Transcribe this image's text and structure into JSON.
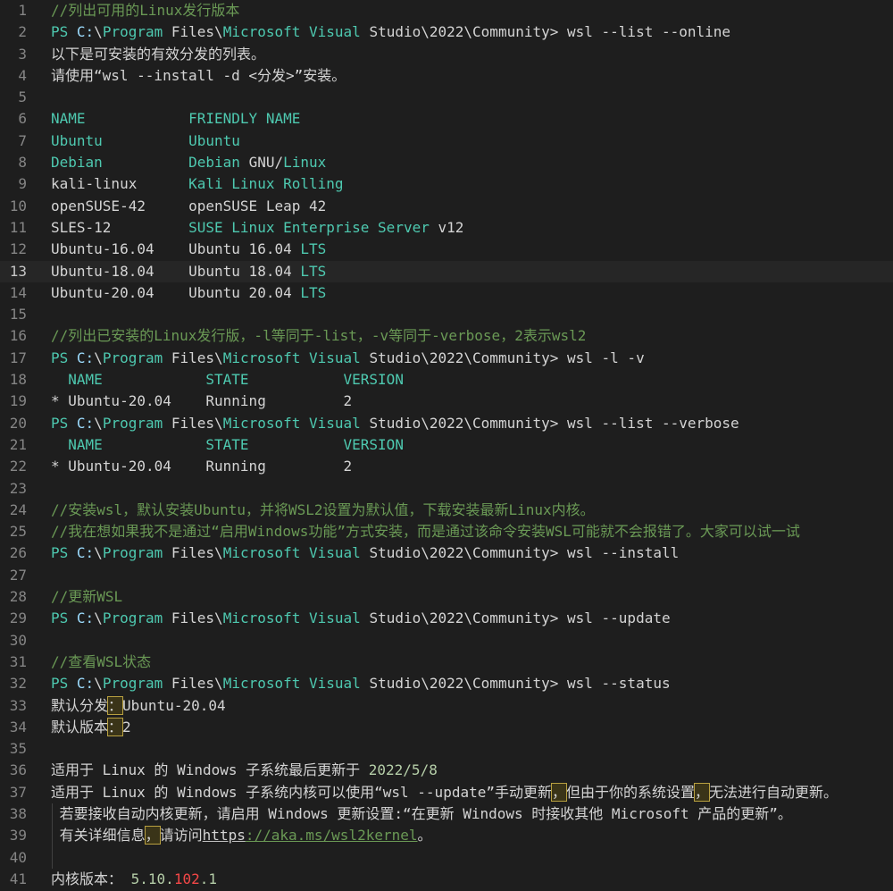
{
  "colors": {
    "background": "#1e1e1e",
    "comment": "#6a9955",
    "type": "#4ec9b0",
    "text": "#d4d4d4",
    "number": "#b5cea8",
    "error": "#f44747"
  },
  "current_line": 13,
  "lines": [
    [
      [
        "//列出可用的Linux发行版本",
        "c"
      ]
    ],
    [
      [
        "PS ",
        "t"
      ],
      [
        "C:",
        "b"
      ],
      [
        "\\",
        "w"
      ],
      [
        "Program",
        "t"
      ],
      [
        " Files\\",
        "w"
      ],
      [
        "Microsoft Visual",
        "t"
      ],
      [
        " Studio\\2022\\Community> wsl --list --online",
        "w"
      ]
    ],
    [
      [
        "以下是可安装的有效分发的列表。",
        "w"
      ]
    ],
    [
      [
        "请使用“wsl --install -d <分发>”安装。",
        "w"
      ]
    ],
    [],
    [
      [
        "NAME            FRIENDLY NAME",
        "t"
      ]
    ],
    [
      [
        "Ubuntu          Ubuntu",
        "t"
      ]
    ],
    [
      [
        "Debian          Debian ",
        "t"
      ],
      [
        "GNU/",
        "w"
      ],
      [
        "Linux",
        "t"
      ]
    ],
    [
      [
        "kali-linux      ",
        "w"
      ],
      [
        "Kali Linux Rolling",
        "t"
      ]
    ],
    [
      [
        "openSUSE-42     ",
        "w"
      ],
      [
        "openSUSE Leap 42",
        "w"
      ]
    ],
    [
      [
        "SLES-12         ",
        "w"
      ],
      [
        "SUSE Linux Enterprise Server ",
        "t"
      ],
      [
        "v12",
        "w"
      ]
    ],
    [
      [
        "Ubuntu-16.04    Ubuntu 16.04 ",
        "w"
      ],
      [
        "LTS",
        "t"
      ]
    ],
    [
      [
        "Ubuntu-18.04    Ubuntu 18.04 ",
        "w"
      ],
      [
        "LTS",
        "t"
      ]
    ],
    [
      [
        "Ubuntu-20.04    Ubuntu 20.04 ",
        "w"
      ],
      [
        "LTS",
        "t"
      ]
    ],
    [],
    [
      [
        "//列出已安装的Linux发行版，-l等同于-list，-v等同于-verbose，2表示wsl2",
        "c"
      ]
    ],
    [
      [
        "PS ",
        "t"
      ],
      [
        "C:",
        "b"
      ],
      [
        "\\",
        "w"
      ],
      [
        "Program",
        "t"
      ],
      [
        " Files\\",
        "w"
      ],
      [
        "Microsoft Visual",
        "t"
      ],
      [
        " Studio\\2022\\Community> wsl -l -v",
        "w"
      ]
    ],
    [
      [
        "  NAME            STATE           VERSION",
        "t"
      ]
    ],
    [
      [
        "* Ubuntu-20.04    Running         2",
        "w"
      ]
    ],
    [
      [
        "PS ",
        "t"
      ],
      [
        "C:",
        "b"
      ],
      [
        "\\",
        "w"
      ],
      [
        "Program",
        "t"
      ],
      [
        " Files\\",
        "w"
      ],
      [
        "Microsoft Visual",
        "t"
      ],
      [
        " Studio\\2022\\Community> wsl --list --verbose",
        "w"
      ]
    ],
    [
      [
        "  NAME            STATE           VERSION",
        "t"
      ]
    ],
    [
      [
        "* Ubuntu-20.04    Running         2",
        "w"
      ]
    ],
    [],
    [
      [
        "//安装wsl，默认安装Ubuntu，并将WSL2设置为默认值，下载安装最新Linux内核。",
        "c"
      ]
    ],
    [
      [
        "//我在想如果我不是通过“启用Windows功能”方式安装，而是通过该命令安装WSL可能就不会报错了。大家可以试一试",
        "c"
      ]
    ],
    [
      [
        "PS ",
        "t"
      ],
      [
        "C:",
        "b"
      ],
      [
        "\\",
        "w"
      ],
      [
        "Program",
        "t"
      ],
      [
        " Files\\",
        "w"
      ],
      [
        "Microsoft Visual",
        "t"
      ],
      [
        " Studio\\2022\\Community> wsl --install",
        "w"
      ]
    ],
    [],
    [
      [
        "//更新WSL",
        "c"
      ]
    ],
    [
      [
        "PS ",
        "t"
      ],
      [
        "C:",
        "b"
      ],
      [
        "\\",
        "w"
      ],
      [
        "Program",
        "t"
      ],
      [
        " Files\\",
        "w"
      ],
      [
        "Microsoft Visual",
        "t"
      ],
      [
        " Studio\\2022\\Community> wsl --update",
        "w"
      ]
    ],
    [],
    [
      [
        "//查看WSL状态",
        "c"
      ]
    ],
    [
      [
        "PS ",
        "t"
      ],
      [
        "C:",
        "b"
      ],
      [
        "\\",
        "w"
      ],
      [
        "Program",
        "t"
      ],
      [
        " Files\\",
        "w"
      ],
      [
        "Microsoft Visual",
        "t"
      ],
      [
        " Studio\\2022\\Community> wsl --status",
        "w"
      ]
    ],
    [
      [
        "默认分发",
        "w"
      ],
      [
        "：",
        "h"
      ],
      [
        "Ubuntu-20.04",
        "w"
      ]
    ],
    [
      [
        "默认版本",
        "w"
      ],
      [
        "：",
        "h"
      ],
      [
        "2",
        "w"
      ]
    ],
    [],
    [
      [
        "适用于 Linux 的 Windows 子系统最后更新于 ",
        "w"
      ],
      [
        "2022/5/8",
        "n"
      ]
    ],
    [
      [
        "适用于 Linux 的 Windows 子系统内核可以使用“wsl --update”手动更新",
        "w"
      ],
      [
        "，",
        "h"
      ],
      [
        "但由于你的系统设置",
        "w"
      ],
      [
        "，",
        "h"
      ],
      [
        "无法进行自动更新。",
        "w"
      ]
    ],
    [
      [
        " 若要接收自动内核更新，请启用 Windows 更新设置:“在更新 Windows 时接收其他 Microsoft 产品的更新”。",
        "w"
      ]
    ],
    [
      [
        " 有关详细信息",
        "w"
      ],
      [
        "，",
        "h"
      ],
      [
        "请访问",
        "w"
      ],
      [
        "https",
        "u"
      ],
      [
        "://aka.ms/wsl2kernel",
        "ug"
      ],
      [
        "。",
        "w"
      ]
    ],
    [
      [
        " ",
        "w"
      ]
    ],
    [
      [
        "内核版本： ",
        "w"
      ],
      [
        "5.10.",
        "n"
      ],
      [
        "102",
        "r"
      ],
      [
        ".1",
        "n"
      ]
    ]
  ]
}
